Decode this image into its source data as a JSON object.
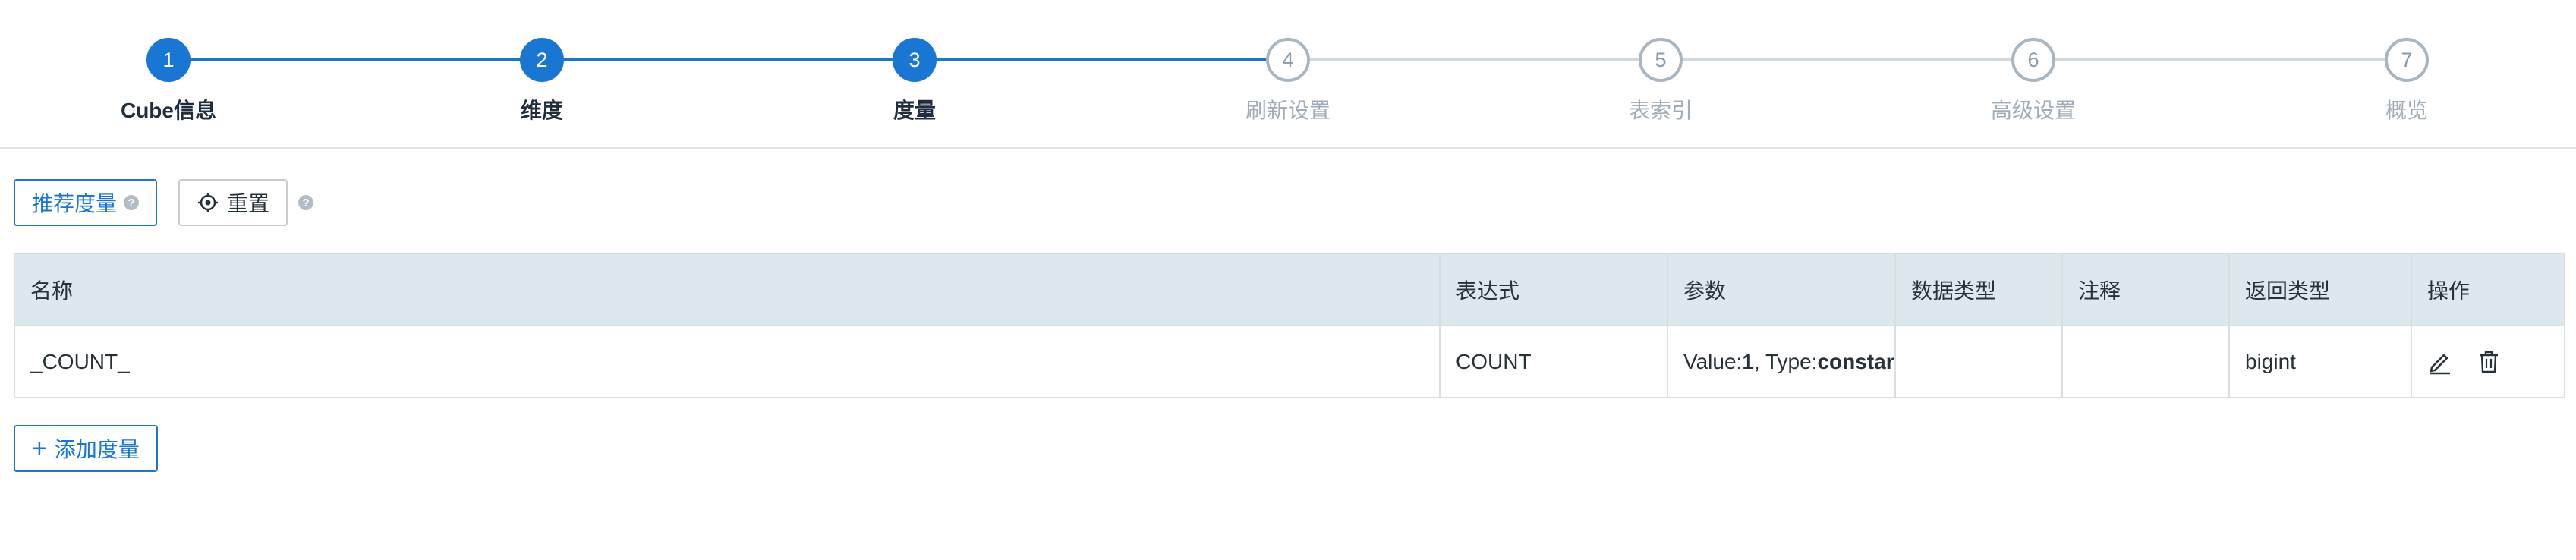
{
  "steps": [
    {
      "number": "1",
      "label": "Cube信息",
      "done": true
    },
    {
      "number": "2",
      "label": "维度",
      "done": true
    },
    {
      "number": "3",
      "label": "度量",
      "done": true
    },
    {
      "number": "4",
      "label": "刷新设置",
      "done": false
    },
    {
      "number": "5",
      "label": "表索引",
      "done": false
    },
    {
      "number": "6",
      "label": "高级设置",
      "done": false
    },
    {
      "number": "7",
      "label": "概览",
      "done": false
    }
  ],
  "toolbar": {
    "recommend_label": "推荐度量",
    "reset_label": "重置",
    "help_glyph": "?"
  },
  "table": {
    "headers": [
      "名称",
      "表达式",
      "参数",
      "数据类型",
      "注释",
      "返回类型",
      "操作"
    ],
    "rows": [
      {
        "name": "_COUNT_",
        "expression": "COUNT",
        "param_value_key": "Value:",
        "param_value": "1",
        "param_sep": ", Type:",
        "param_type": "constant",
        "data_type": "",
        "comment": "",
        "return_type": "bigint"
      }
    ]
  },
  "add_measure": {
    "plus": "+",
    "label": "添加度量"
  },
  "colors": {
    "primary": "#1976d2",
    "header_bg": "#dde7ee",
    "inactive_step": "#a8b6c2"
  },
  "icons": [
    "help-icon",
    "reset-icon",
    "edit-icon",
    "delete-icon",
    "plus-icon"
  ]
}
